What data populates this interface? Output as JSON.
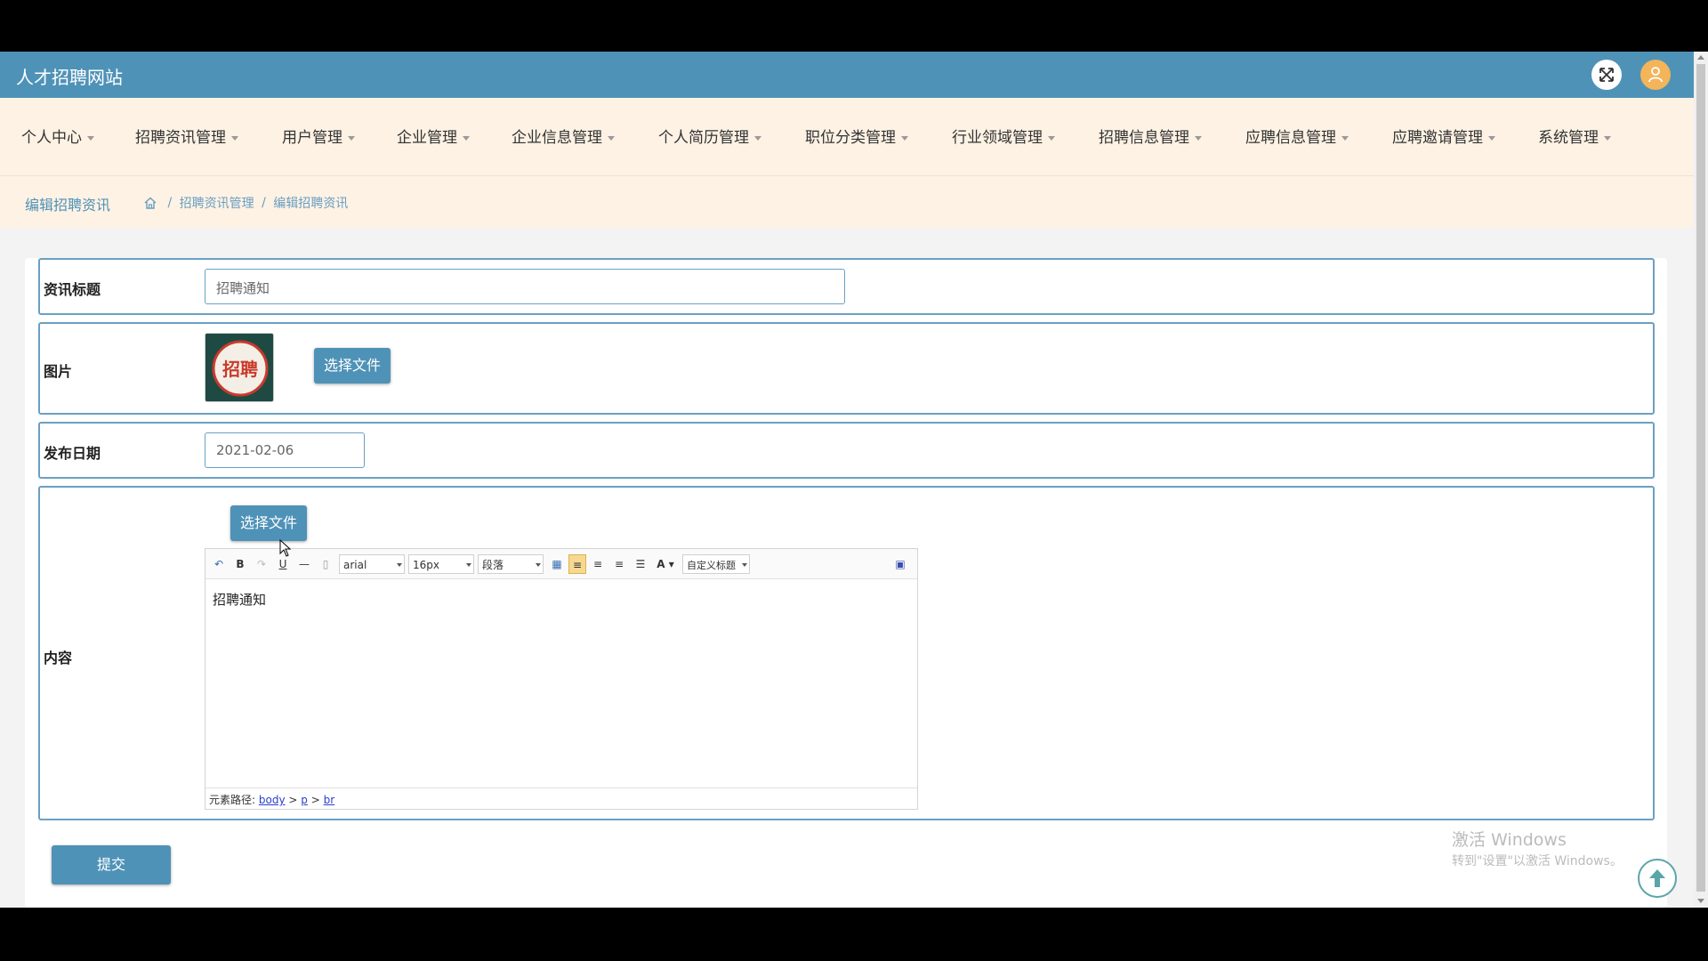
{
  "header": {
    "site_title": "人才招聘网站"
  },
  "nav": {
    "items": [
      {
        "label": "个人中心"
      },
      {
        "label": "招聘资讯管理"
      },
      {
        "label": "用户管理"
      },
      {
        "label": "企业管理"
      },
      {
        "label": "企业信息管理"
      },
      {
        "label": "个人简历管理"
      },
      {
        "label": "职位分类管理"
      },
      {
        "label": "行业领域管理"
      },
      {
        "label": "招聘信息管理"
      },
      {
        "label": "应聘信息管理"
      },
      {
        "label": "应聘邀请管理"
      },
      {
        "label": "系统管理"
      }
    ]
  },
  "breadcrumb": {
    "title": "编辑招聘资讯",
    "separator": "/",
    "path": [
      "招聘资讯管理",
      "编辑招聘资讯"
    ]
  },
  "form": {
    "title_label": "资讯标题",
    "title_value": "招聘通知",
    "image_label": "图片",
    "image_button": "选择文件",
    "image_thumb_text": "招聘",
    "date_label": "发布日期",
    "date_value": "2021-02-06",
    "content_label": "内容",
    "content_upload_button": "选择文件",
    "submit_button": "提交"
  },
  "editor": {
    "font_family": "arial",
    "font_size": "16px",
    "paragraph": "段落",
    "custom_heading": "自定义标题",
    "body_text": "招聘通知",
    "path_label": "元素路径:",
    "path": [
      "body",
      "p",
      "br"
    ],
    "path_sep": ">"
  },
  "watermark": {
    "line1": "激活 Windows",
    "line2": "转到\"设置\"以激活 Windows。"
  },
  "colors": {
    "primary": "#4f92b7",
    "nav_bg": "#fdf2e4",
    "avatar": "#f3b45a"
  }
}
